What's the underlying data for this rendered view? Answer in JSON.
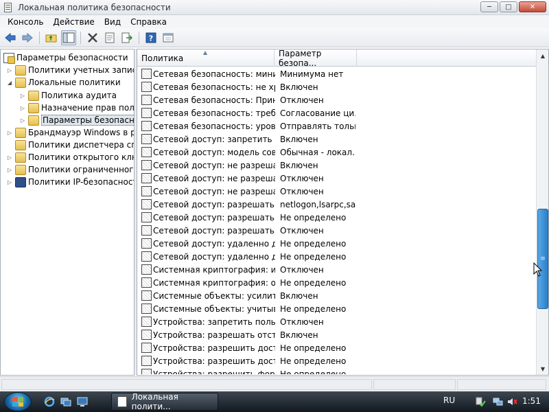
{
  "window": {
    "title": "Локальная политика безопасности",
    "buttons": {
      "minimize": "─",
      "maximize": "□",
      "close": "✕"
    }
  },
  "menu": [
    "Консоль",
    "Действие",
    "Вид",
    "Справка"
  ],
  "toolbar": {
    "icons": [
      "back-arrow-icon",
      "forward-arrow-icon",
      "up-folder-icon",
      "show-tree-icon",
      "delete-icon",
      "properties-icon",
      "export-list-icon",
      "help-icon",
      "console-tree-icon"
    ]
  },
  "tree": {
    "root": "Параметры безопасности",
    "items": [
      {
        "label": "Политики учетных записей",
        "level": 1,
        "expanded": false,
        "icon": "folder-policy"
      },
      {
        "label": "Локальные политики",
        "level": 1,
        "expanded": true,
        "icon": "folder-policy"
      },
      {
        "label": "Политика аудита",
        "level": 2,
        "expanded": false,
        "icon": "folder-policy"
      },
      {
        "label": "Назначение прав пользователя",
        "level": 2,
        "expanded": false,
        "icon": "folder-policy"
      },
      {
        "label": "Параметры безопасности",
        "level": 2,
        "expanded": false,
        "icon": "folder-policy",
        "selected": true
      },
      {
        "label": "Брандмауэр Windows в режиме",
        "level": 1,
        "expanded": false,
        "icon": "folder"
      },
      {
        "label": "Политики диспетчера списков",
        "level": 1,
        "expanded": null,
        "icon": "folder"
      },
      {
        "label": "Политики открытого ключа",
        "level": 1,
        "expanded": false,
        "icon": "folder"
      },
      {
        "label": "Политики ограниченного использования",
        "level": 1,
        "expanded": false,
        "icon": "folder"
      },
      {
        "label": "Политики IP-безопасности",
        "level": 1,
        "expanded": false,
        "icon": "ip-security"
      }
    ]
  },
  "list": {
    "columns": [
      "Политика",
      "Параметр безопа..."
    ],
    "rows": [
      [
        "Сетевая безопасность: миним...",
        "Минимума нет"
      ],
      [
        "Сетевая безопасность: не хра...",
        "Включен"
      ],
      [
        "Сетевая безопасность: Прину...",
        "Отключен"
      ],
      [
        "Сетевая безопасность: требов...",
        "Согласование ци..."
      ],
      [
        "Сетевая безопасность: уровен...",
        "Отправлять тольк..."
      ],
      [
        "Сетевой доступ: запретить ан...",
        "Включен"
      ],
      [
        "Сетевой доступ: модель совм...",
        "Обычная - локал..."
      ],
      [
        "Сетевой доступ: не разрешать...",
        "Включен"
      ],
      [
        "Сетевой доступ: не разрешать...",
        "Отключен"
      ],
      [
        "Сетевой доступ: не разрешать...",
        "Отключен"
      ],
      [
        "Сетевой доступ: разрешать ан...",
        "netlogon,lsarpc,sa..."
      ],
      [
        "Сетевой доступ: разрешать ан...",
        "Не определено"
      ],
      [
        "Сетевой доступ: разрешать пр...",
        "Отключен"
      ],
      [
        "Сетевой доступ: удаленно дос...",
        "Не определено"
      ],
      [
        "Сетевой доступ: удаленно дос...",
        "Не определено"
      ],
      [
        "Системная криптография: ис...",
        "Отключен"
      ],
      [
        "Системная криптография: об...",
        "Не определено"
      ],
      [
        "Системные объекты: усилить ...",
        "Включен"
      ],
      [
        "Системные объекты: учитыва...",
        "Не определено"
      ],
      [
        "Устройства: запретить пользо...",
        "Отключен"
      ],
      [
        "Устройства: разрешать отсты...",
        "Включен"
      ],
      [
        "Устройства: разрешить досту...",
        "Не определено"
      ],
      [
        "Устройства: разрешить досту...",
        "Не определено"
      ],
      [
        "Устройства: разрешить форм...",
        "Не определено"
      ]
    ]
  },
  "taskbar": {
    "task_label": "Локальная полити...",
    "language": "RU",
    "clock": "1:51"
  }
}
